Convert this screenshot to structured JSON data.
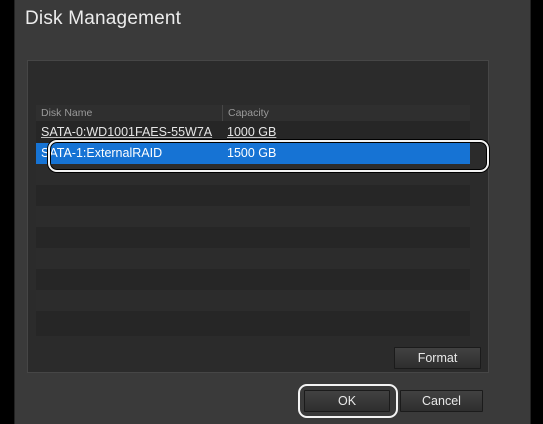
{
  "dialog": {
    "title": "Disk Management"
  },
  "table": {
    "columns": {
      "name": "Disk Name",
      "capacity": "Capacity"
    },
    "rows": [
      {
        "name": "SATA-0:WD1001FAES-55W7A",
        "capacity": "1000 GB"
      },
      {
        "name": "SATA-1:ExternalRAID",
        "capacity": "1500 GB",
        "selected": true
      }
    ],
    "empty_row_count": 8
  },
  "buttons": {
    "format": "Format",
    "ok": "OK",
    "cancel": "Cancel"
  },
  "colors": {
    "selection": "#1673d4",
    "background": "#3a3a3a"
  }
}
